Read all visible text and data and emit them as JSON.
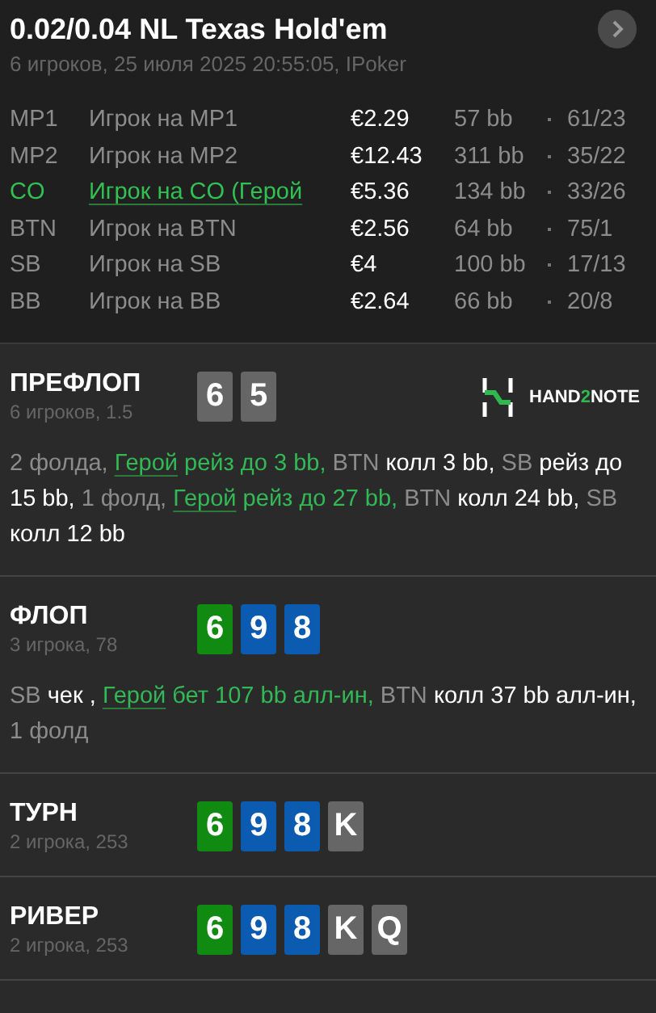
{
  "header": {
    "title": "0.02/0.04 NL Texas Hold'em",
    "subtitle": "6 игроков, 25 июля 2025 20:55:05, IPoker"
  },
  "players": [
    {
      "position": "MP1",
      "name": "Игрок на MP1",
      "stack": "€2.29",
      "bb": "57 bb",
      "stats": "61/23",
      "hero": false
    },
    {
      "position": "MP2",
      "name": "Игрок на MP2",
      "stack": "€12.43",
      "bb": "311 bb",
      "stats": "35/22",
      "hero": false
    },
    {
      "position": "CO",
      "name": "Игрок на CO (Герой",
      "stack": "€5.36",
      "bb": "134 bb",
      "stats": "33/26",
      "hero": true
    },
    {
      "position": "BTN",
      "name": "Игрок на BTN",
      "stack": "€2.56",
      "bb": "64 bb",
      "stats": "75/1",
      "hero": false
    },
    {
      "position": "SB",
      "name": "Игрок на SB",
      "stack": "€4",
      "bb": "100 bb",
      "stats": "17/13",
      "hero": false
    },
    {
      "position": "BB",
      "name": "Игрок на BB",
      "stack": "€2.64",
      "bb": "66 bb",
      "stats": "20/8",
      "hero": false
    }
  ],
  "logo": [
    "HAND",
    "2",
    "NOTE"
  ],
  "streets": [
    {
      "name": "ПРЕФЛОП",
      "info": "6 игроков, 1.5",
      "cards": [
        {
          "rank": "6",
          "color": "#666666"
        },
        {
          "rank": "5",
          "color": "#666666"
        }
      ],
      "actions": [
        {
          "kind": "muted",
          "text": "2 фолда, "
        },
        {
          "kind": "hero",
          "link": "Герой",
          "text": " рейз до 3 bb, "
        },
        {
          "kind": "muted",
          "text": "BTN "
        },
        {
          "kind": "act",
          "text": "колл 3 bb, "
        },
        {
          "kind": "muted",
          "text": "SB "
        },
        {
          "kind": "act",
          "text": "рейз до 15 bb, "
        },
        {
          "kind": "muted",
          "text": "1 фолд, "
        },
        {
          "kind": "hero",
          "link": "Герой",
          "text": " рейз до 27 bb, "
        },
        {
          "kind": "muted",
          "text": "BTN "
        },
        {
          "kind": "act",
          "text": "колл 24 bb, "
        },
        {
          "kind": "muted",
          "text": "SB "
        },
        {
          "kind": "act",
          "text": "колл 12 bb"
        }
      ]
    },
    {
      "name": "ФЛОП",
      "info": "3 игрока, 78",
      "cards": [
        {
          "rank": "6",
          "color": "#108a10"
        },
        {
          "rank": "9",
          "color": "#0b5bb0"
        },
        {
          "rank": "8",
          "color": "#0b5bb0"
        }
      ],
      "actions": [
        {
          "kind": "muted",
          "text": "SB "
        },
        {
          "kind": "act",
          "text": "чек , "
        },
        {
          "kind": "hero",
          "link": "Герой",
          "text": " бет 107 bb алл-ин, "
        },
        {
          "kind": "muted",
          "text": "BTN "
        },
        {
          "kind": "act",
          "text": "колл 37 bb алл-ин, "
        },
        {
          "kind": "muted",
          "text": "1 фолд"
        }
      ]
    },
    {
      "name": "ТУРН",
      "info": "2 игрока, 253",
      "cards": [
        {
          "rank": "6",
          "color": "#108a10"
        },
        {
          "rank": "9",
          "color": "#0b5bb0"
        },
        {
          "rank": "8",
          "color": "#0b5bb0"
        },
        {
          "rank": "K",
          "color": "#666666"
        }
      ]
    },
    {
      "name": "РИВЕР",
      "info": "2 игрока, 253",
      "cards": [
        {
          "rank": "6",
          "color": "#108a10"
        },
        {
          "rank": "9",
          "color": "#0b5bb0"
        },
        {
          "rank": "8",
          "color": "#0b5bb0"
        },
        {
          "rank": "K",
          "color": "#666666"
        },
        {
          "rank": "Q",
          "color": "#666666"
        }
      ]
    }
  ]
}
